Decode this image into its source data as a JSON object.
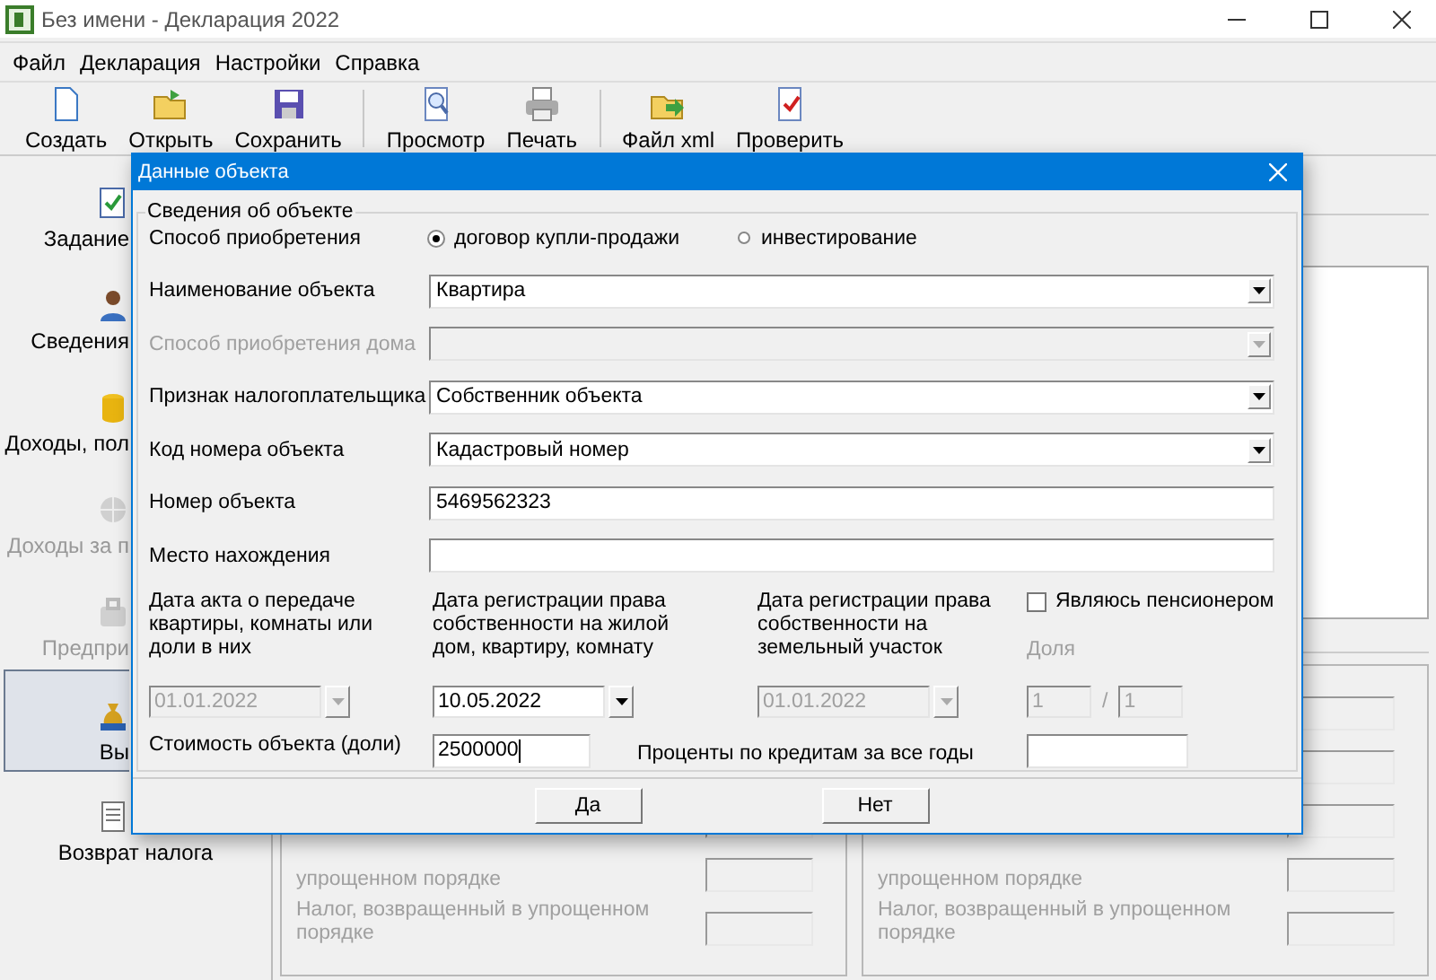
{
  "window": {
    "title": "Без имени - Декларация 2022"
  },
  "menu": [
    "Файл",
    "Декларация",
    "Настройки",
    "Справка"
  ],
  "toolbar": [
    [
      "Создать",
      "Открыть",
      "Сохранить"
    ],
    [
      "Просмотр",
      "Печать"
    ],
    [
      "Файл xml",
      "Проверить"
    ]
  ],
  "sidebar": {
    "items": [
      {
        "label": "Задание",
        "selected": false,
        "disabled": false
      },
      {
        "label": "Сведения",
        "selected": false,
        "disabled": false
      },
      {
        "label": "Доходы, пол",
        "selected": false,
        "disabled": false
      },
      {
        "label": "Доходы за п",
        "selected": false,
        "disabled": true
      },
      {
        "label": "Предпри",
        "selected": false,
        "disabled": true
      },
      {
        "label": "Вы",
        "selected": true,
        "disabled": false
      },
      {
        "label": "Возврат налога",
        "selected": false,
        "disabled": false
      }
    ]
  },
  "panels": [
    {
      "rows": [
        {
          "label": "упрощенном порядке"
        },
        {
          "label": "Налог, возвращенный в упрощенном порядке"
        }
      ]
    },
    {
      "rows": [
        {
          "label": "упрощенном порядке"
        },
        {
          "label": "Налог, возвращенный в упрощенном порядке"
        }
      ]
    }
  ],
  "dialog": {
    "title": "Данные объекта",
    "group_title": "Сведения об объекте",
    "acquisition": {
      "label": "Способ приобретения",
      "options": [
        {
          "label": "договор купли-продажи",
          "selected": true
        },
        {
          "label": "инвестирование",
          "selected": false
        }
      ]
    },
    "fields": [
      {
        "kind": "dropdown",
        "label": "Наименование объекта",
        "value": "Квартира",
        "disabled": false
      },
      {
        "kind": "dropdown",
        "label": "Способ приобретения дома",
        "disabled": true
      },
      {
        "kind": "dropdown",
        "label": "Признак налогоплательщика",
        "value": "Собственник объекта",
        "disabled": false
      },
      {
        "kind": "dropdown",
        "label": "Код номера объекта",
        "value": "Кадастровый номер",
        "disabled": false
      },
      {
        "kind": "text",
        "label": "Номер объекта",
        "value": "5469562323",
        "disabled": false
      },
      {
        "kind": "text",
        "label": "Место нахождения",
        "disabled": false
      }
    ],
    "dates": [
      {
        "label": "Дата акта о передаче квартиры, комнаты или доли в них",
        "value": "01.01.2022",
        "disabled": true
      },
      {
        "label": "Дата регистрации права собственности на жилой дом, квартиру, комнату",
        "value": "10.05.2022",
        "disabled": false
      },
      {
        "label": "Дата регистрации права собственности на земельный участок",
        "value": "01.01.2022",
        "disabled": true
      }
    ],
    "pensioner": {
      "label": "Являюсь пенсионером",
      "checked": false
    },
    "share": {
      "label": "Доля",
      "numerator": "1",
      "separator": "/",
      "denominator": "1",
      "disabled": true
    },
    "cost": {
      "label": "Стоимость объекта (доли)",
      "value": "2500000"
    },
    "interest": {
      "label": "Проценты по кредитам за все годы"
    },
    "buttons": [
      "Да",
      "Нет"
    ]
  }
}
